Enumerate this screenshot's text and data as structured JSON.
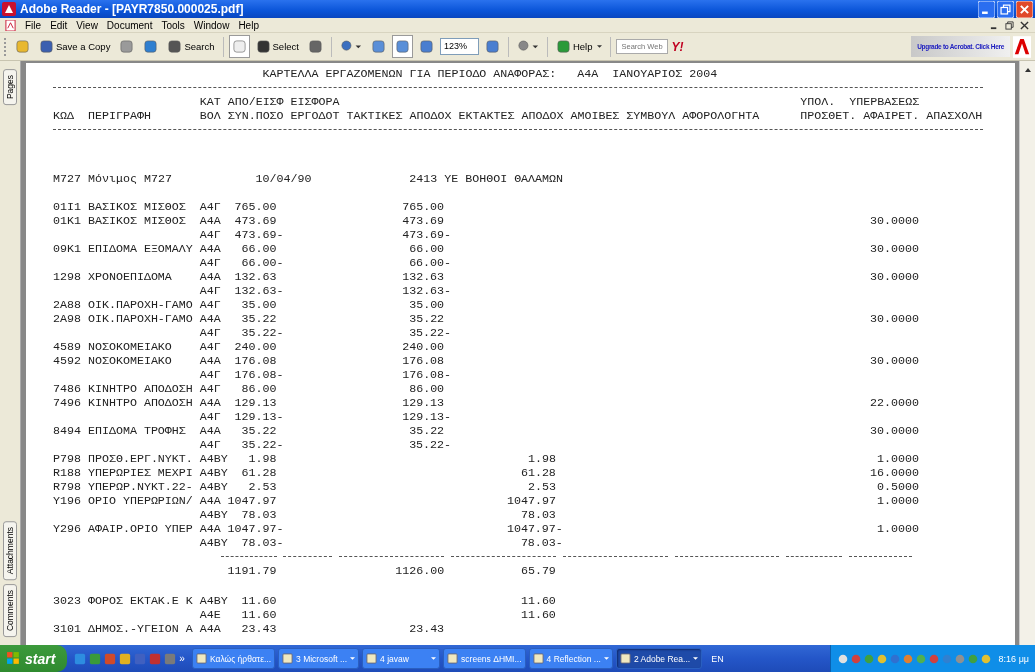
{
  "window": {
    "title": "Adobe Reader - [PAYR7850.000025.pdf]"
  },
  "menu": [
    "File",
    "Edit",
    "View",
    "Document",
    "Tools",
    "Window",
    "Help"
  ],
  "toolbar": [
    {
      "kind": "icon",
      "selected": false
    },
    {
      "kind": "labeled",
      "label": "Save a Copy",
      "selected": false
    },
    {
      "kind": "icon",
      "selected": false
    },
    {
      "kind": "icon",
      "selected": false
    },
    {
      "kind": "labeled",
      "label": "Search",
      "selected": false
    },
    {
      "kind": "sep"
    },
    {
      "kind": "icon",
      "selected": true
    },
    {
      "kind": "labeled",
      "label": "Select",
      "selected": false
    },
    {
      "kind": "icon",
      "selected": false
    },
    {
      "kind": "sep"
    },
    {
      "kind": "dropdown",
      "selected": false
    },
    {
      "kind": "icon",
      "selected": false
    },
    {
      "kind": "icon",
      "selected": true
    },
    {
      "kind": "icon",
      "selected": false
    },
    {
      "kind": "zoomfield",
      "value": "123%"
    },
    {
      "kind": "icon",
      "selected": false
    },
    {
      "kind": "sep"
    },
    {
      "kind": "dropdown",
      "selected": false
    },
    {
      "kind": "sep"
    },
    {
      "kind": "labeled",
      "label": "Help",
      "selected": false,
      "caret": true
    },
    {
      "kind": "sep"
    },
    {
      "kind": "search",
      "placeholder": "Search Web"
    },
    {
      "kind": "text",
      "label": "Y!"
    }
  ],
  "upgrade_banner": {
    "label": "Upgrade to Acrobat. Click Here"
  },
  "side_tabs_top": [
    {
      "label": "Pages"
    }
  ],
  "side_tabs_bottom": [
    {
      "label": "Attachments"
    },
    {
      "label": "Comments"
    }
  ],
  "document": {
    "title": "ΚΑΡΤΕΛΛΑ ΕΡΓΑΖΟΜΕΝΩΝ ΓΙΑ ΠΕΡΙΟΔΟ ΑΝΑΦΟΡΑΣ:   Α4Α  ΙΑΝΟΥΑΡΙΟΣ 2004",
    "header_lines": [
      {
        "middle": "ΚΑΤ ΑΠΟ/ΕΙΣΦ ΕΙΣΦΟΡΑ",
        "right": "ΥΠΟΛ.  ΥΠΕΡΒΑΣΕΩΣ"
      },
      {
        "left": "ΚΩΔ  ΠΕΡΙΓΡΑΦΗ",
        "middle": "ΒΟΛ ΣΥΝ.ΠΟΣΟ ΕΡΓΟΔΟΤ ΤΑΚΤΙΚΕΣ ΑΠΟΔΟΧ ΕΚΤΑΚΤΕΣ ΑΠΟΔΟΧ ΑΜΟΙΒΕΣ ΣΥΜΒΟΥΛ ΑΦΟΡΟΛΟΓΗΤΑ",
        "right": "ΠΡΟΣΘΕΤ. ΑΦΑΙΡΕΤ. ΑΠΑΣΧΟΛΗ"
      }
    ],
    "employee": {
      "name": "Μ727 Μόνιμος Μ727",
      "date": "10/04/90",
      "position": "2413 ΥΕ ΒΟΗΘΟΙ ΘΑΛΑΜΩΝ"
    },
    "rows": [
      {
        "code": "01Ι1",
        "description": "ΒΑΣΙΚΟΣ ΜΙΣΘΟΣ",
        "category": "Α4Γ",
        "amount": "765.00",
        "regular": "765.00"
      },
      {
        "code": "01Κ1",
        "description": "ΒΑΣΙΚΟΣ ΜΙΣΘΟΣ",
        "category": "Α4Α",
        "amount": "473.69",
        "regular": "473.69",
        "hours": "30.0000"
      },
      {
        "category": "Α4Γ",
        "amount": "473.69-",
        "regular": "473.69-"
      },
      {
        "code": "09Κ1",
        "description": "ΕΠΙΔΟΜΑ ΕΞΟΜΑΛΥ",
        "category": "Α4Α",
        "amount": "66.00",
        "regular": "66.00",
        "hours": "30.0000"
      },
      {
        "category": "Α4Γ",
        "amount": "66.00-",
        "regular": "66.00-"
      },
      {
        "code": "1298",
        "description": "ΧΡΟΝΟΕΠΙΔΟΜΑ",
        "category": "Α4Α",
        "amount": "132.63",
        "regular": "132.63",
        "hours": "30.0000"
      },
      {
        "category": "Α4Γ",
        "amount": "132.63-",
        "regular": "132.63-"
      },
      {
        "code": "2Α88",
        "description": "ΟΙΚ.ΠΑΡΟΧΗ-ΓΑΜΟ",
        "category": "Α4Γ",
        "amount": "35.00",
        "regular": "35.00"
      },
      {
        "code": "2Α98",
        "description": "ΟΙΚ.ΠΑΡΟΧΗ-ΓΑΜΟ",
        "category": "Α4Α",
        "amount": "35.22",
        "regular": "35.22",
        "hours": "30.0000"
      },
      {
        "category": "Α4Γ",
        "amount": "35.22-",
        "regular": "35.22-"
      },
      {
        "code": "4589",
        "description": "ΝΟΣΟΚΟΜΕΙΑΚΟ",
        "category": "Α4Γ",
        "amount": "240.00",
        "regular": "240.00"
      },
      {
        "code": "4592",
        "description": "ΝΟΣΟΚΟΜΕΙΑΚΟ",
        "category": "Α4Α",
        "amount": "176.08",
        "regular": "176.08",
        "hours": "30.0000"
      },
      {
        "category": "Α4Γ",
        "amount": "176.08-",
        "regular": "176.08-"
      },
      {
        "code": "7486",
        "description": "ΚΙΝΗΤΡΟ ΑΠΟΔΟΣΗ",
        "category": "Α4Γ",
        "amount": "86.00",
        "regular": "86.00"
      },
      {
        "code": "7496",
        "description": "ΚΙΝΗΤΡΟ ΑΠΟΔΟΣΗ",
        "category": "Α4Α",
        "amount": "129.13",
        "regular": "129.13",
        "hours": "22.0000"
      },
      {
        "category": "Α4Γ",
        "amount": "129.13-",
        "regular": "129.13-"
      },
      {
        "code": "8494",
        "description": "ΕΠΙΔΟΜΑ ΤΡΟΦΗΣ",
        "category": "Α4Α",
        "amount": "35.22",
        "regular": "35.22",
        "hours": "30.0000"
      },
      {
        "category": "Α4Γ",
        "amount": "35.22-",
        "regular": "35.22-"
      },
      {
        "code": "Ρ798",
        "description": "ΠΡΟΣΘ.ΕΡΓ.ΝΥΚΤ.",
        "category": "Α4ΒΥ",
        "amount": "1.98",
        "extra": "1.98",
        "hours": "1.0000"
      },
      {
        "code": "R188",
        "description": "ΥΠΕΡΩΡΙΕΣ ΜΕΧΡΙ",
        "category": "Α4ΒΥ",
        "amount": "61.28",
        "extra": "61.28",
        "hours": "16.0000"
      },
      {
        "code": "R798",
        "description": "ΥΠΕΡΩΡ.ΝΥΚΤ.22-",
        "category": "Α4ΒΥ",
        "amount": "2.53",
        "extra": "2.53",
        "hours": "0.5000"
      },
      {
        "code": "Y196",
        "description": "ΟΡΙΟ ΥΠΕΡΩΡΙΩΝ/",
        "category": "Α4Α",
        "amount": "1047.97",
        "extra": "1047.97",
        "hours": "1.0000"
      },
      {
        "category": "Α4ΒΥ",
        "amount": "78.03",
        "extra": "78.03"
      },
      {
        "code": "Y296",
        "description": "ΑΦΑΙΡ.ΟΡΙΟ ΥΠΕΡ",
        "category": "Α4Α",
        "amount": "1047.97-",
        "extra": "1047.97-",
        "hours": "1.0000"
      },
      {
        "category": "Α4ΒΥ",
        "amount": "78.03-",
        "extra": "78.03-"
      }
    ],
    "totals": {
      "amount": "1191.79",
      "regular": "1126.00",
      "extra": "65.79"
    },
    "rows_after": [
      {
        "code": "3023",
        "description": "ΦΟΡΟΣ ΕΚΤΑΚ.Ε Κ",
        "category": "Α4ΒΥ",
        "amount": "11.60",
        "extra": "11.60"
      },
      {
        "category": "Α4Ε",
        "amount": "11.60",
        "extra": "11.60"
      },
      {
        "code": "3101",
        "description": "ΔΗΜΟΣ.-ΥΓΕΙΟΝ Α",
        "category": "Α4Α",
        "amount": "23.43",
        "regular": "23.43"
      }
    ]
  },
  "taskbar": {
    "start": "start",
    "overflow": "»",
    "tasks": [
      {
        "label": "Καλώς ήρθατε...",
        "selected": false
      },
      {
        "label": "3 Microsoft ...",
        "selected": false,
        "caret": true
      },
      {
        "label": "4 javaw",
        "selected": false,
        "caret": true
      },
      {
        "label": "screens ΔΗΜΙ...",
        "selected": false
      },
      {
        "label": "4 Reflection ...",
        "selected": false,
        "caret": true
      },
      {
        "label": "2 Adobe Rea...",
        "selected": true,
        "caret": true
      }
    ],
    "language": "EN",
    "clock": "8:16 μμ"
  }
}
